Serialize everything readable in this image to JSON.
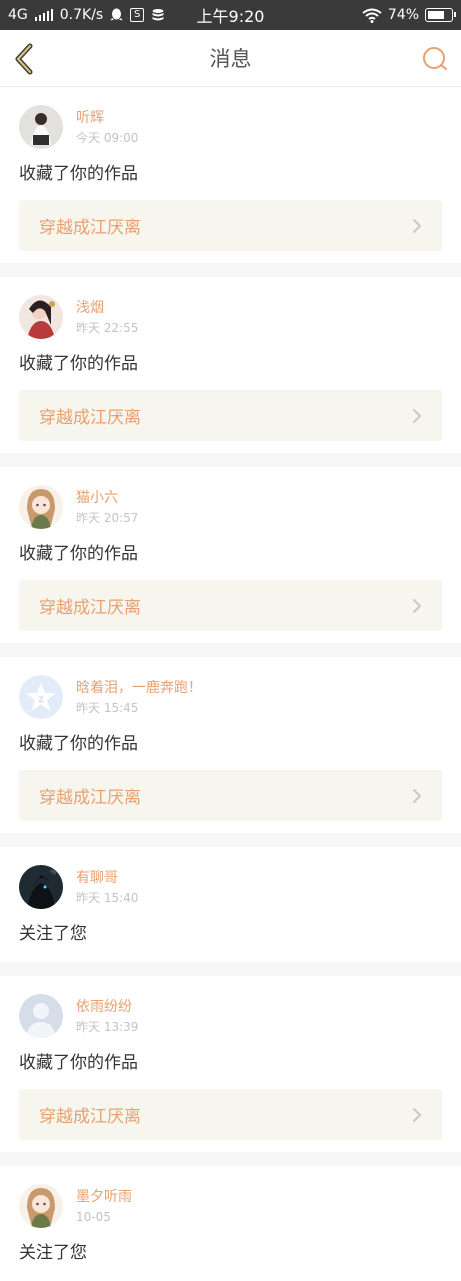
{
  "status_bar": {
    "network": "4G",
    "speed": "0.7K/s",
    "time": "上午9:20",
    "battery": "74%",
    "battery_level": 0.74
  },
  "header": {
    "title": "消息"
  },
  "messages": [
    {
      "username": "听辉",
      "time": "今天 09:00",
      "action": "收藏了你的作品",
      "work_title": "穿越成江厌离",
      "avatar_icon": "photo-avatar"
    },
    {
      "username": "浅烟",
      "time": "昨天 22:55",
      "action": "收藏了你的作品",
      "work_title": "穿越成江厌离",
      "avatar_icon": "illustration-avatar"
    },
    {
      "username": "猫小六",
      "time": "昨天 20:57",
      "action": "收藏了你的作品",
      "work_title": "穿越成江厌离",
      "avatar_icon": "anime-avatar"
    },
    {
      "username": "晗着泪，一鹿奔跑！",
      "time": "昨天 15:45",
      "action": "收藏了你的作品",
      "work_title": "穿越成江厌离",
      "avatar_icon": "default-star-avatar"
    },
    {
      "username": "有聊哥",
      "time": "昨天 15:40",
      "action": "关注了您",
      "avatar_icon": "dark-avatar"
    },
    {
      "username": "依雨纷纷",
      "time": "昨天 13:39",
      "action": "收藏了你的作品",
      "work_title": "穿越成江厌离",
      "avatar_icon": "default-person-avatar"
    },
    {
      "username": "墨夕听雨",
      "time": "10-05",
      "action": "关注了您",
      "avatar_icon": "anime-avatar"
    }
  ],
  "colors": {
    "accent": "#e8a070",
    "link_bg": "#f6f6ee",
    "status_bar": "#3a3a3a"
  }
}
